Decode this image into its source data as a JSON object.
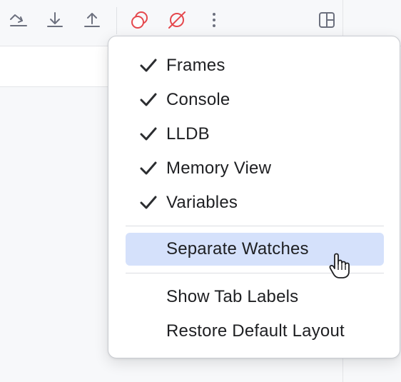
{
  "colors": {
    "accent_red": "#e5484d",
    "icon_gray": "#6c707e",
    "selection": "#d5e1fb",
    "menu_text": "#1e1f22"
  },
  "toolbar": {
    "buttons": [
      {
        "name": "run-to-cursor-icon"
      },
      {
        "name": "step-into-icon"
      },
      {
        "name": "step-out-icon"
      },
      {
        "name": "view-breakpoints-icon"
      },
      {
        "name": "mute-breakpoints-icon"
      },
      {
        "name": "more-vertical-icon"
      },
      {
        "name": "layout-settings-icon"
      }
    ]
  },
  "menu": {
    "items": [
      {
        "label": "Frames",
        "checked": true
      },
      {
        "label": "Console",
        "checked": true
      },
      {
        "label": "LLDB",
        "checked": true
      },
      {
        "label": "Memory View",
        "checked": true
      },
      {
        "label": "Variables",
        "checked": true
      },
      {
        "label": "Separate Watches",
        "checked": false,
        "highlighted": true
      },
      {
        "label": "Show Tab Labels",
        "checked": false
      },
      {
        "label": "Restore Default Layout",
        "checked": false
      }
    ]
  },
  "cursor": {
    "type": "hand-pointer"
  }
}
